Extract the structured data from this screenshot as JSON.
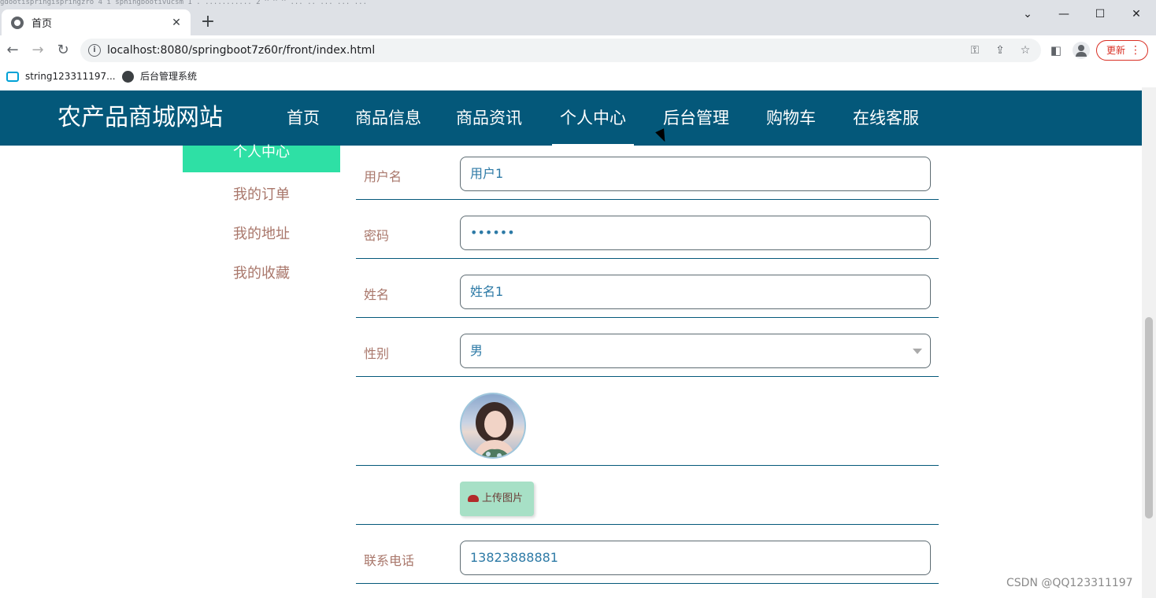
{
  "browser": {
    "tab_title": "首页",
    "tab_close": "✕",
    "new_tab": "+",
    "bleed_text": "gdootispringispringzro 4 i sphingbootivucsm 1 .   ........... 2 ^ ^ ^ ... .. ... ... ...",
    "window_controls": {
      "dropdown": "⌄",
      "minimize": "—",
      "maximize": "☐",
      "close": "✕"
    },
    "url": "localhost:8080/springboot7z60r/front/index.html",
    "update_label": "更新",
    "update_menu": "⋮",
    "bookmarks": [
      {
        "label": "string123311197..."
      },
      {
        "label": "后台管理系统"
      }
    ]
  },
  "header": {
    "logo": "农产品商城网站",
    "nav": [
      "首页",
      "商品信息",
      "商品资讯",
      "个人中心",
      "后台管理",
      "购物车",
      "在线客服"
    ],
    "active_nav": "个人中心"
  },
  "sidebar": {
    "active": "个人中心",
    "items": [
      "我的订单",
      "我的地址",
      "我的收藏"
    ]
  },
  "form": {
    "username_label": "用户名",
    "username_value": "用户1",
    "password_label": "密码",
    "password_value": "••••••",
    "name_label": "姓名",
    "name_value": "姓名1",
    "gender_label": "性别",
    "gender_value": "男",
    "upload_label": "上传图片",
    "phone_label": "联系电话",
    "phone_value": "13823888881"
  },
  "watermark": "CSDN @QQ123311197",
  "colors": {
    "header_bg": "#04587a",
    "sidebar_active_bg": "#2ee0a5",
    "label_color": "#a9776b",
    "upload_bg": "#a7e0c6"
  }
}
